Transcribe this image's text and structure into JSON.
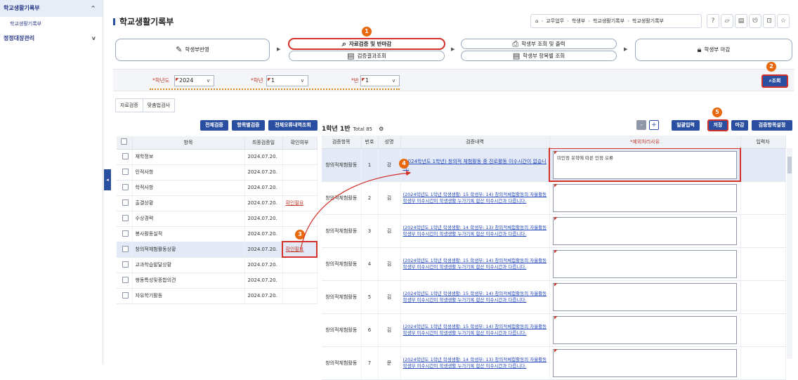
{
  "sidebar": {
    "items": [
      {
        "label": "학교생활기록부",
        "chevron": "^"
      },
      {
        "label": "학교생활기록부"
      },
      {
        "label": "정정대장관리",
        "chevron": "v"
      }
    ],
    "collapse_glyph": "◂"
  },
  "header": {
    "title": "학교생활기록부",
    "breadcrumb": [
      "교무업무",
      "학생부",
      "학교생활기록부",
      "학교생활기록부"
    ],
    "tool_icons": [
      "help-icon",
      "bookmark-icon",
      "document-icon",
      "tools-icon",
      "export-icon",
      "star-icon"
    ]
  },
  "flow": {
    "step1": "학생부반영",
    "step2a": "자료검증 및 반마감",
    "step2b": "검증결과조회",
    "step3a": "학생부 조회 및 출력",
    "step3b": "학생부 항목별 조회",
    "step4": "학생부 마감"
  },
  "filters": {
    "year_label": "*학년도",
    "year_value": "2024",
    "grade_label": "*학년",
    "grade_value": "1",
    "class_label": "*반",
    "class_value": "1",
    "search_button": "조회"
  },
  "tabs": [
    "자료검증",
    "맞춤법검사"
  ],
  "left_buttons": [
    "전체검증",
    "항목별검증",
    "전체오류내역조회"
  ],
  "left_table": {
    "headers": [
      "항목",
      "최종검증일",
      "확인여부"
    ],
    "rows": [
      {
        "item": "재학정보",
        "date": "2024.07.20.",
        "status": ""
      },
      {
        "item": "인적사항",
        "date": "2024.07.20.",
        "status": ""
      },
      {
        "item": "학적사항",
        "date": "2024.07.20.",
        "status": ""
      },
      {
        "item": "출결상황",
        "date": "2024.07.20.",
        "status": "확인필요"
      },
      {
        "item": "수상경력",
        "date": "2024.07.20.",
        "status": ""
      },
      {
        "item": "봉사활동실적",
        "date": "2024.07.20.",
        "status": ""
      },
      {
        "item": "창의적체험활동상황",
        "date": "2024.07.20.",
        "status": "확인필요"
      },
      {
        "item": "교과학습발달상황",
        "date": "2024.07.20.",
        "status": ""
      },
      {
        "item": "행동특성및종합의견",
        "date": "2024.07.20.",
        "status": ""
      },
      {
        "item": "자유학기활동",
        "date": "2024.07.20.",
        "status": ""
      }
    ]
  },
  "right": {
    "title": "1학년 1반",
    "total": "Total 85",
    "buttons": {
      "minus": "-",
      "plus": "+",
      "bulk": "일괄입력",
      "save": "저장",
      "close": "마감",
      "settings": "검증항목설정"
    },
    "headers": [
      "검증항목",
      "번호",
      "성명",
      "검증내역",
      "*예외처리사유",
      "입력자"
    ],
    "rows": [
      {
        "category": "창의적체험활동",
        "no": "1",
        "name": "강",
        "detail": "(2024학년도 1학년) 창의적 체험활동 중 진로활동 이수시간이 없습니다.",
        "reason": "미인정 유학에 따른 인정 오류"
      },
      {
        "category": "창의적체험활동",
        "no": "2",
        "name": "김",
        "detail": "(2024학년도 1학년 학생생활: 15 학생부: 14) 창의적체험활동의 자율활동 학생부 이수시간이 학생생활 누가기록 합산 이수시간과 다릅니다.",
        "reason": ""
      },
      {
        "category": "창의적체험활동",
        "no": "3",
        "name": "김",
        "detail": "(2024학년도 1학년 학생생활: 14 학생부: 13) 창의적체험활동의 자율활동 학생부 이수시간이 학생생활 누가기록 합산 이수시간과 다릅니다.",
        "reason": ""
      },
      {
        "category": "창의적체험활동",
        "no": "4",
        "name": "김",
        "detail": "(2024학년도 1학년 학생생활: 15 학생부: 14) 창의적체험활동의 자율활동 학생부 이수시간이 학생생활 누가기록 합산 이수시간과 다릅니다.",
        "reason": ""
      },
      {
        "category": "창의적체험활동",
        "no": "5",
        "name": "김",
        "detail": "(2024학년도 1학년 학생생활: 15 학생부: 14) 창의적체험활동의 자율활동 학생부 이수시간이 학생생활 누가기록 합산 이수시간과 다릅니다.",
        "reason": ""
      },
      {
        "category": "창의적체험활동",
        "no": "6",
        "name": "김",
        "detail": "(2024학년도 1학년 학생생활: 15 학생부: 14) 창의적체험활동의 자율활동 학생부 이수시간이 학생생활 누가기록 합산 이수시간과 다릅니다.",
        "reason": ""
      },
      {
        "category": "창의적체험활동",
        "no": "7",
        "name": "문",
        "detail": "(2024학년도 1학년 학생생활: 14 학생부: 13) 창의적체험활동의 자율활동 학생부 이수시간이 학생생활 누가기록 합산 이수시간과 다릅니다.",
        "reason": ""
      }
    ]
  },
  "annotations": {
    "badges": [
      "1",
      "2",
      "3",
      "4",
      "5"
    ],
    "color": "#d4312a",
    "badge_color": "#e8690d"
  },
  "colors": {
    "primary": "#2b4fa0",
    "required": "#c0392b",
    "link": "#2146b8"
  }
}
